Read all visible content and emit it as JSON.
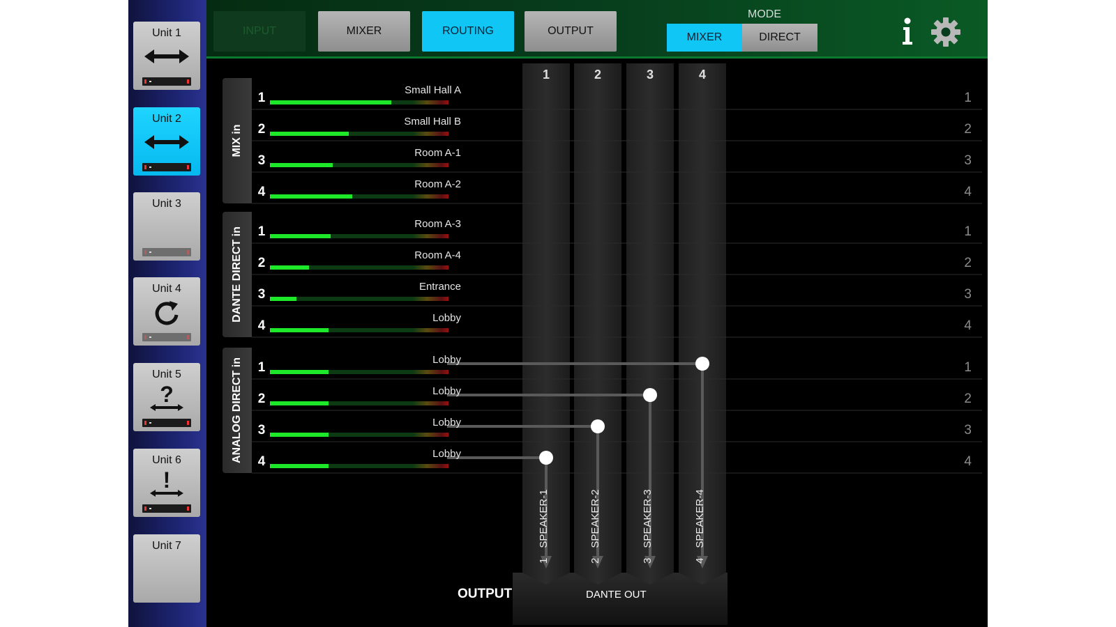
{
  "sidebar": {
    "units": [
      {
        "label": "Unit 1",
        "icon": "double-arrow-icon",
        "active": false
      },
      {
        "label": "Unit 2",
        "icon": "double-arrow-icon",
        "active": true
      },
      {
        "label": "Unit 3",
        "icon": "",
        "active": false
      },
      {
        "label": "Unit 4",
        "icon": "refresh-icon",
        "active": false
      },
      {
        "label": "Unit 5",
        "icon": "question-icon",
        "active": false
      },
      {
        "label": "Unit 6",
        "icon": "warning-icon",
        "active": false
      },
      {
        "label": "Unit 7",
        "icon": "",
        "active": false
      }
    ]
  },
  "topbar": {
    "tabs": [
      {
        "label": "INPUT",
        "state": "disabled"
      },
      {
        "label": "MIXER",
        "state": "normal"
      },
      {
        "label": "ROUTING",
        "state": "active"
      },
      {
        "label": "OUTPUT",
        "state": "normal"
      }
    ],
    "mode_label": "MODE",
    "mode_mixer": "MIXER",
    "mode_direct": "DIRECT",
    "selected_mode": "MIXER"
  },
  "colors": {
    "accent": "#10c6f4",
    "meter_green": "#1ee82a",
    "sidebar": "#1c2470",
    "topbar": "#073d1c"
  },
  "groups": [
    {
      "label": "MIX in",
      "rows": [
        {
          "num": "1",
          "name": "Small Hall A",
          "level": 0.68,
          "right_num": "1"
        },
        {
          "num": "2",
          "name": "Small Hall B",
          "level": 0.44,
          "right_num": "2"
        },
        {
          "num": "3",
          "name": "Room A-1",
          "level": 0.35,
          "right_num": "3"
        },
        {
          "num": "4",
          "name": "Room A-2",
          "level": 0.46,
          "right_num": "4"
        }
      ]
    },
    {
      "label": "DANTE DIRECT in",
      "rows": [
        {
          "num": "1",
          "name": "Room A-3",
          "level": 0.34,
          "right_num": "1"
        },
        {
          "num": "2",
          "name": "Room A-4",
          "level": 0.22,
          "right_num": "2"
        },
        {
          "num": "3",
          "name": "Entrance",
          "level": 0.15,
          "right_num": "3"
        },
        {
          "num": "4",
          "name": "Lobby",
          "level": 0.33,
          "right_num": "4"
        }
      ]
    },
    {
      "label": "ANALOG DIRECT in",
      "rows": [
        {
          "num": "1",
          "name": "Lobby",
          "level": 0.33,
          "right_num": "1",
          "route": 4
        },
        {
          "num": "2",
          "name": "Lobby",
          "level": 0.33,
          "right_num": "2",
          "route": 3
        },
        {
          "num": "3",
          "name": "Lobby",
          "level": 0.33,
          "right_num": "3",
          "route": 2
        },
        {
          "num": "4",
          "name": "Lobby",
          "level": 0.33,
          "right_num": "4",
          "route": 1
        }
      ]
    }
  ],
  "outputs": [
    {
      "header": "1",
      "num": "1",
      "name": "SPEAKER-1"
    },
    {
      "header": "2",
      "num": "2",
      "name": "SPEAKER-2"
    },
    {
      "header": "3",
      "num": "3",
      "name": "SPEAKER-3"
    },
    {
      "header": "4",
      "num": "4",
      "name": "SPEAKER-4"
    }
  ],
  "output_label": "OUTPUT",
  "dante_out_label": "DANTE OUT"
}
